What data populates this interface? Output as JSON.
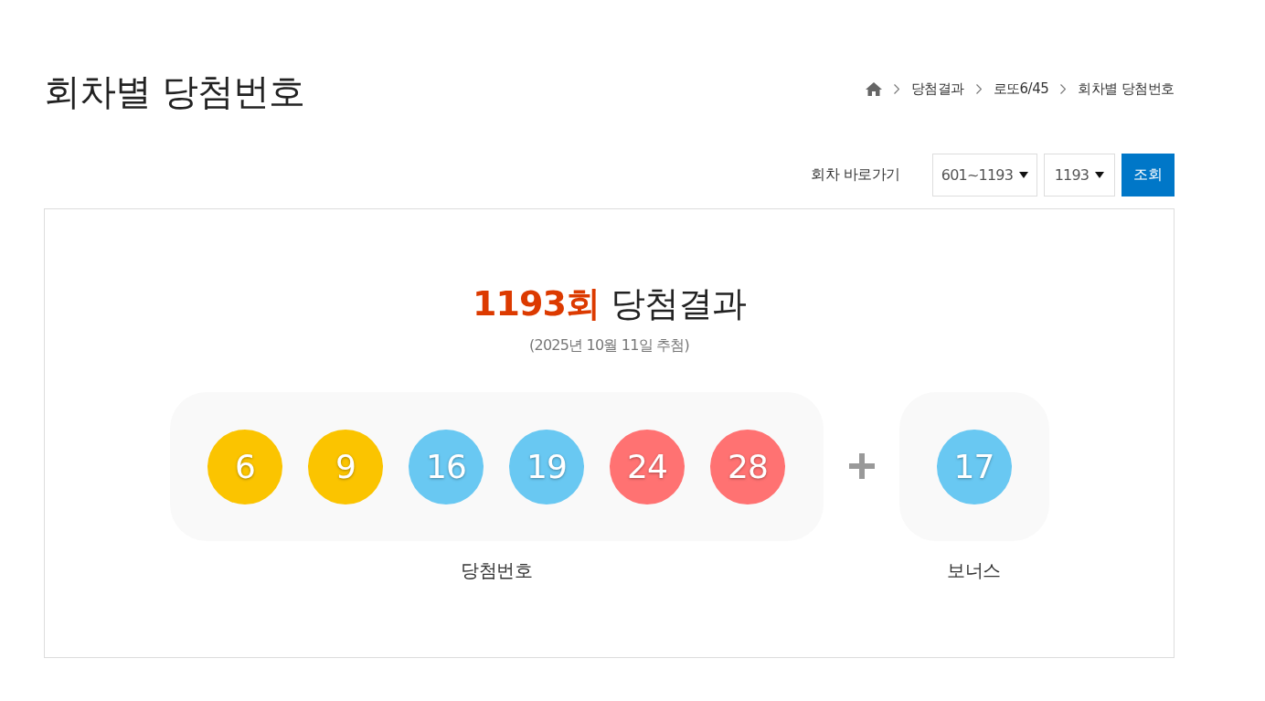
{
  "page_title": "회차별 당첨번호",
  "breadcrumb": [
    "당첨결과",
    "로또6/45",
    "회차별 당첨번호"
  ],
  "round_picker": {
    "label": "회차 바로가기",
    "range": "601~1193",
    "round": "1193",
    "button": "조회"
  },
  "result": {
    "round": "1193회",
    "heading": "당첨결과",
    "date": "(2025년 10월 11일 추첨)",
    "winning_numbers": {
      "label": "당첨번호",
      "balls": [
        {
          "number": "6",
          "color": "#fbc400"
        },
        {
          "number": "9",
          "color": "#fbc400"
        },
        {
          "number": "16",
          "color": "#69c8f2"
        },
        {
          "number": "19",
          "color": "#69c8f2"
        },
        {
          "number": "24",
          "color": "#ff7272"
        },
        {
          "number": "28",
          "color": "#ff7272"
        }
      ]
    },
    "bonus": {
      "label": "보너스",
      "ball": {
        "number": "17",
        "color": "#69c8f2"
      }
    }
  }
}
